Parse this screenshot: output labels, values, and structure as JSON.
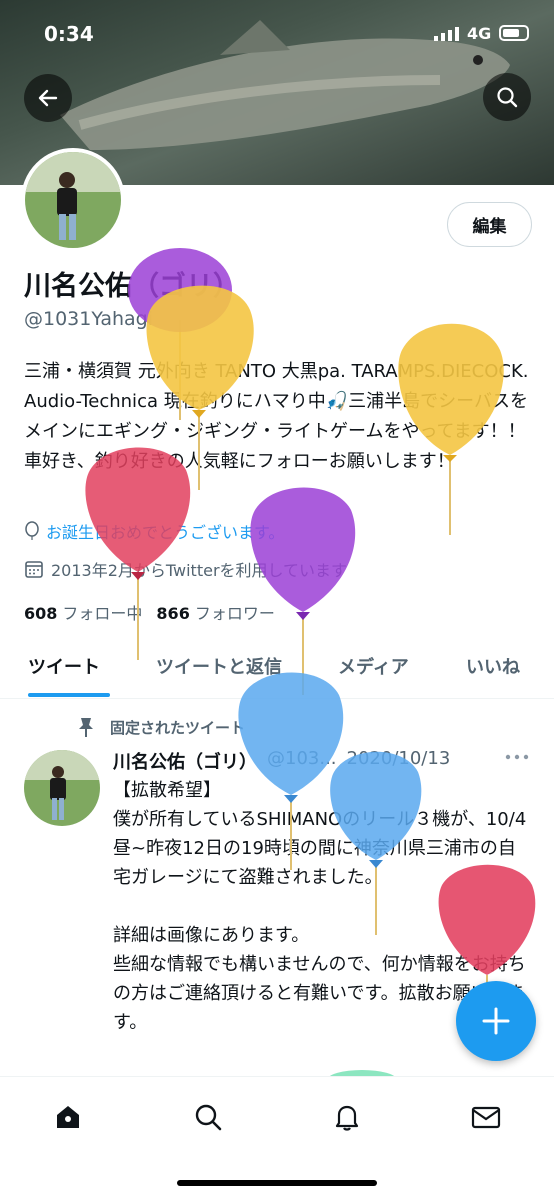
{
  "status_bar": {
    "time": "0:34",
    "network": "4G"
  },
  "header": {
    "edit_label": "編集"
  },
  "profile": {
    "name": "川名公佑（ゴリ）",
    "handle": "@1031Yahagi",
    "bio": "三浦・横須賀 元外向き TANTO 大黒pa. TARAMPS.DIECOCK. Audio-Technica 現在釣りにハマり中🎣三浦半島でシーバスをメインにエギング・ジギング・ライトゲームをやってます！！車好き、釣り好きの人気軽にフォローお願いします！",
    "birthday": "お誕生日おめでとうございます。",
    "joined": "2013年2月からTwitterを利用しています",
    "following_count": "608",
    "following_label": "フォロー中",
    "followers_count": "866",
    "followers_label": "フォロワー"
  },
  "tabs": [
    "ツイート",
    "ツイートと返信",
    "メディア",
    "いいね"
  ],
  "pinned_tweet": {
    "pinned_label": "固定されたツイート",
    "author": "川名公佑（ゴリ）",
    "handle": "@103...",
    "date": "2020/10/13",
    "text": "【拡散希望】\n僕が所有しているSHIMANOのリール３機が、10/4昼~昨夜12日の19時頃の間に神奈川県三浦市の自宅ガレージにて盗難されました。\n\n詳細は画像にあります。\n些細な情報でも構いませんので、何か情報をお持ちの方はご連絡頂けると有難いです。拡散お願いします。"
  },
  "colors": {
    "accent": "#1d9bf0",
    "balloon_purple": "#9b3fd6",
    "balloon_yellow": "#f4c542",
    "balloon_red": "#e23f5e",
    "balloon_blue": "#59a8ef"
  },
  "icons": {
    "back": "arrow-left-icon",
    "search": "search-icon",
    "balloon": "balloon-icon",
    "calendar": "calendar-icon",
    "pin": "pin-icon",
    "more": "more-icon",
    "compose": "plus-icon",
    "nav": [
      "home-icon",
      "search-icon",
      "bell-icon",
      "mail-icon"
    ]
  }
}
